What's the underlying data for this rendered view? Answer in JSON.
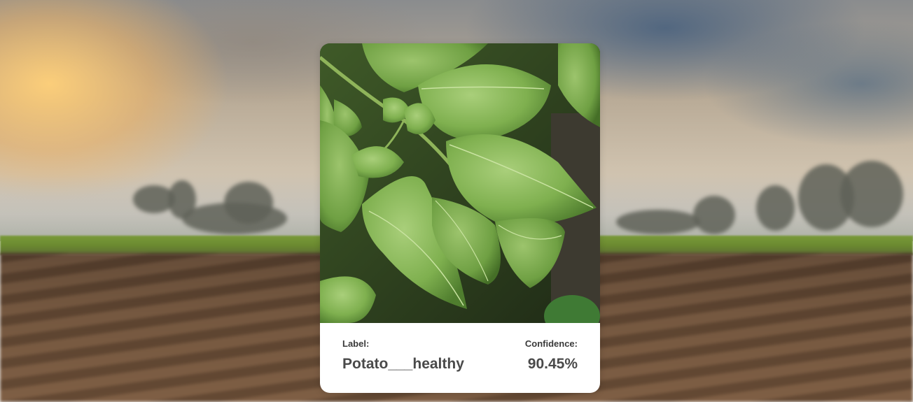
{
  "result": {
    "label_title": "Label:",
    "label_value": "Potato___healthy",
    "confidence_title": "Confidence:",
    "confidence_value": "90.45%"
  },
  "image": {
    "subject": "potato leaves"
  },
  "colors": {
    "card_background": "#ffffff",
    "text_primary": "#4a4a4a",
    "leaf_green": "#7fb04f"
  }
}
